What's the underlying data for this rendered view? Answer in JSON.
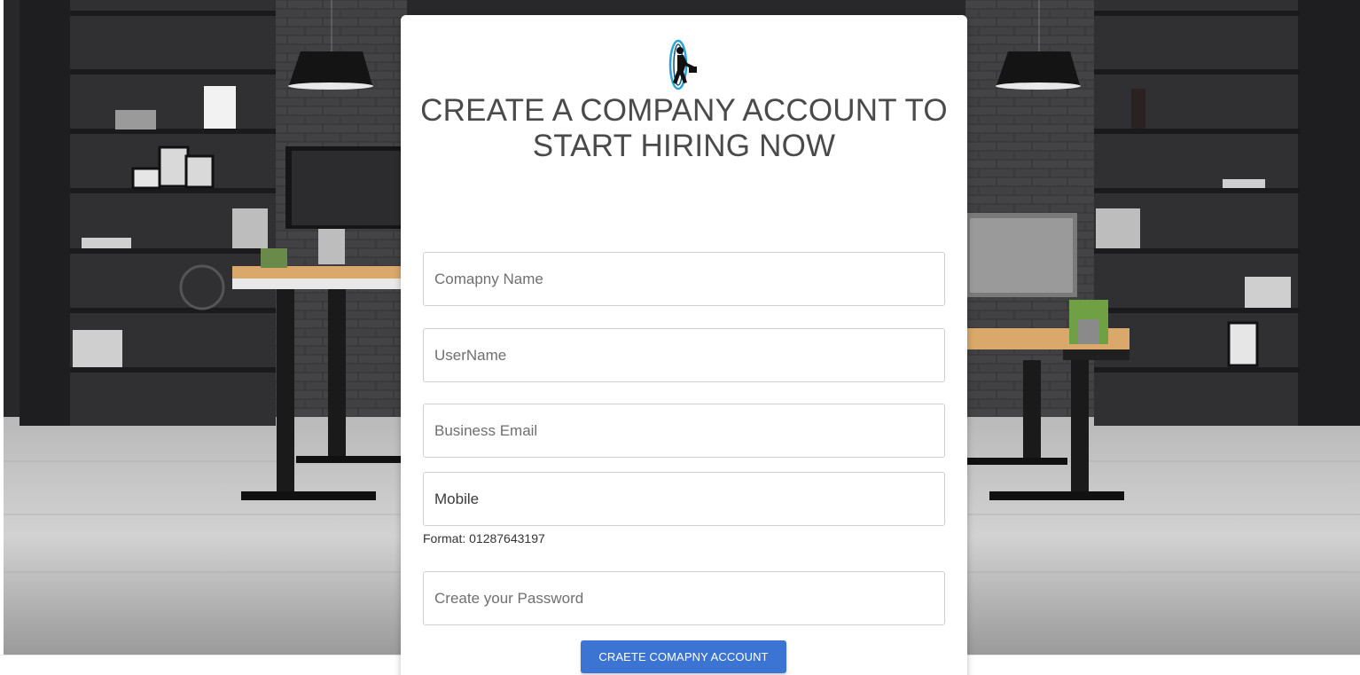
{
  "brand": {
    "logo_icon": "person-with-briefcase-logo-icon",
    "accent_color": "#3c74d4"
  },
  "headline": "CREATE A COMPANY ACCOUNT TO START HIRING NOW",
  "form": {
    "company_name_placeholder": "Comapny Name",
    "username_placeholder": "UserName",
    "email_placeholder": "Business Email",
    "mobile_placeholder": "Mobile",
    "mobile_hint": "Format: 01287643197",
    "password_placeholder": "Create your Password",
    "submit_label": "CRAETE COMAPNY ACCOUNT"
  },
  "background": {
    "scene": "office-interior-with-standing-desks-and-shelves",
    "wall_color": "#2b2b2d",
    "floor_color": "#c9c9c9"
  }
}
